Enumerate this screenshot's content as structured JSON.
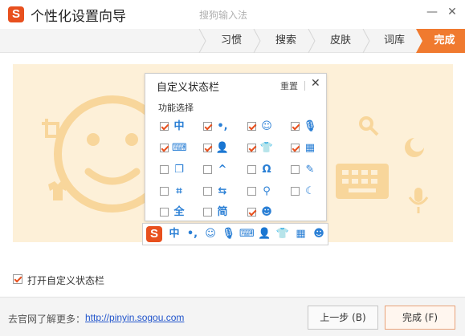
{
  "window": {
    "title": "个性化设置向导",
    "subtitle": "搜狗输入法",
    "logo_letter": "S",
    "minimize_symbol": "—",
    "close_symbol": "✕"
  },
  "tabs": [
    {
      "label": "习惯",
      "active": false
    },
    {
      "label": "搜索",
      "active": false
    },
    {
      "label": "皮肤",
      "active": false
    },
    {
      "label": "词库",
      "active": false
    },
    {
      "label": "完成",
      "active": true
    }
  ],
  "dialog": {
    "title": "自定义状态栏",
    "reset_label": "重置",
    "close_symbol": "✕",
    "section_label": "功能选择",
    "options": [
      {
        "icon": "chinese-mode-icon",
        "glyph": "中",
        "checked": true
      },
      {
        "icon": "punctuation-icon",
        "glyph": "•,",
        "checked": true
      },
      {
        "icon": "emoji-icon",
        "glyph": "☺",
        "checked": true
      },
      {
        "icon": "microphone-icon",
        "glyph": "🎙",
        "checked": true
      },
      {
        "icon": "keyboard-icon",
        "glyph": "⌨",
        "checked": true
      },
      {
        "icon": "user-icon",
        "glyph": "👤",
        "checked": true
      },
      {
        "icon": "shirt-icon",
        "glyph": "👕",
        "checked": true
      },
      {
        "icon": "toolbox-icon",
        "glyph": "▦",
        "checked": true
      },
      {
        "icon": "clipboard-icon",
        "glyph": "❐",
        "checked": false
      },
      {
        "icon": "shortcut-icon",
        "glyph": "^",
        "checked": false
      },
      {
        "icon": "omega-icon",
        "glyph": "Ω",
        "checked": false
      },
      {
        "icon": "pen-icon",
        "glyph": "✎",
        "checked": false
      },
      {
        "icon": "crop-icon",
        "glyph": "⌗",
        "checked": false
      },
      {
        "icon": "translate-icon",
        "glyph": "⇆",
        "checked": false
      },
      {
        "icon": "search-icon",
        "glyph": "⚲",
        "checked": false
      },
      {
        "icon": "moon-icon",
        "glyph": "☾",
        "checked": false
      },
      {
        "icon": "full-width-icon",
        "glyph": "全",
        "checked": false
      },
      {
        "icon": "simplified-icon",
        "glyph": "简",
        "checked": false
      },
      {
        "icon": "avatar-icon",
        "glyph": "☻",
        "checked": true
      }
    ]
  },
  "statusbar": {
    "logo_letter": "S",
    "icons": [
      {
        "icon": "chinese-mode-icon",
        "glyph": "中"
      },
      {
        "icon": "punctuation-icon",
        "glyph": "•,"
      },
      {
        "icon": "emoji-icon",
        "glyph": "☺"
      },
      {
        "icon": "microphone-icon",
        "glyph": "🎙"
      },
      {
        "icon": "keyboard-icon",
        "glyph": "⌨"
      },
      {
        "icon": "user-icon",
        "glyph": "👤"
      },
      {
        "icon": "shirt-icon",
        "glyph": "👕"
      },
      {
        "icon": "toolbox-icon",
        "glyph": "▦"
      },
      {
        "icon": "avatar-icon",
        "glyph": "☻"
      }
    ]
  },
  "enable_custom_statusbar": {
    "label": "打开自定义状态栏",
    "checked": true
  },
  "footer": {
    "text": "去官网了解更多：",
    "link": "http://pinyin.sogou.com",
    "back_label": "上一步 (B)",
    "finish_label": "完成 (F)"
  },
  "colors": {
    "accent": "#e8501e",
    "tab_active": "#f07a2f",
    "preview_bg": "#fdf0d8",
    "icon_blue": "#2a7fd5",
    "link": "#2255cc"
  }
}
